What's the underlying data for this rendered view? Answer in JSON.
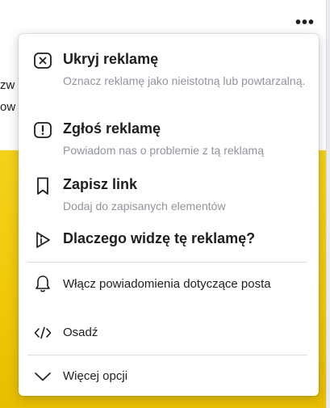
{
  "post": {
    "more_label": "•••",
    "text_line_1": "zw",
    "text_line_2": "ow"
  },
  "menu": {
    "hide_ad": {
      "title": "Ukryj reklamę",
      "description": "Oznacz reklamę jako nieistotną lub powtarzalną."
    },
    "report_ad": {
      "title": "Zgłoś reklamę",
      "description": "Powiadom nas o problemie z tą reklamą"
    },
    "save_link": {
      "title": "Zapisz link",
      "description": "Dodaj do zapisanych elementów"
    },
    "why_ad": {
      "title": "Dlaczego widzę tę reklamę?"
    },
    "notifications": {
      "label": "Włącz powiadomienia dotyczące posta"
    },
    "embed": {
      "label": "Osadź"
    },
    "more_options": {
      "label": "Więcej opcji"
    }
  },
  "colors": {
    "primary_text": "#1c1e21",
    "secondary_text": "#90949c",
    "ad_background": "#f0c808"
  },
  "icons": {
    "hide_ad": "close-square-icon",
    "report_ad": "exclamation-square-icon",
    "save_link": "bookmark-icon",
    "why_ad": "play-info-icon",
    "notifications": "bell-icon",
    "embed": "code-icon",
    "more_options": "chevron-down-icon"
  }
}
